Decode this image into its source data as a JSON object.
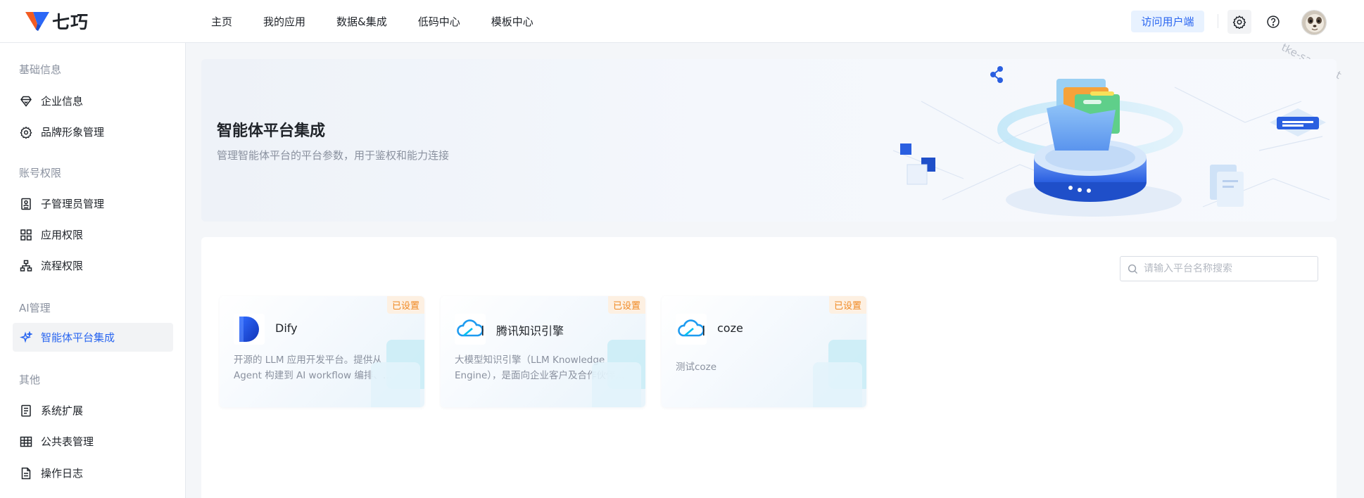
{
  "header": {
    "logo_text": "七巧",
    "nav": [
      "主页",
      "我的应用",
      "数据&集成",
      "低码中心",
      "模板中心"
    ],
    "visit_label": "访问用户端",
    "watermark": "tke-saas-uat"
  },
  "sidebar": {
    "groups": {
      "basic": "基础信息",
      "account": "账号权限",
      "ai": "AI管理",
      "other": "其他"
    },
    "items": {
      "company": "企业信息",
      "brand": "品牌形象管理",
      "subadmin": "子管理员管理",
      "appperm": "应用权限",
      "flowperm": "流程权限",
      "agent": "智能体平台集成",
      "sysext": "系统扩展",
      "pubtable": "公共表管理",
      "oplog": "操作日志"
    }
  },
  "banner": {
    "title": "智能体平台集成",
    "subtitle": "管理智能体平台的平台参数，用于鉴权和能力连接"
  },
  "search": {
    "placeholder": "请输入平台名称搜索"
  },
  "cards": [
    {
      "name": "Dify",
      "badge": "已设置",
      "desc": "开源的 LLM 应用开发平台。提供从 Agent 构建到 AI workflow 编排、RAG..."
    },
    {
      "name": "腾讯知识引擎",
      "badge": "已设置",
      "desc": "大模型知识引擎（LLM Knowledge Engine），是面向企业客户及合作伙伴..."
    },
    {
      "name": "coze",
      "badge": "已设置",
      "desc": "测试coze"
    }
  ],
  "colors": {
    "accent": "#2a66f0",
    "badge_text": "#f08a24",
    "badge_bg": "#fdf0e2"
  }
}
